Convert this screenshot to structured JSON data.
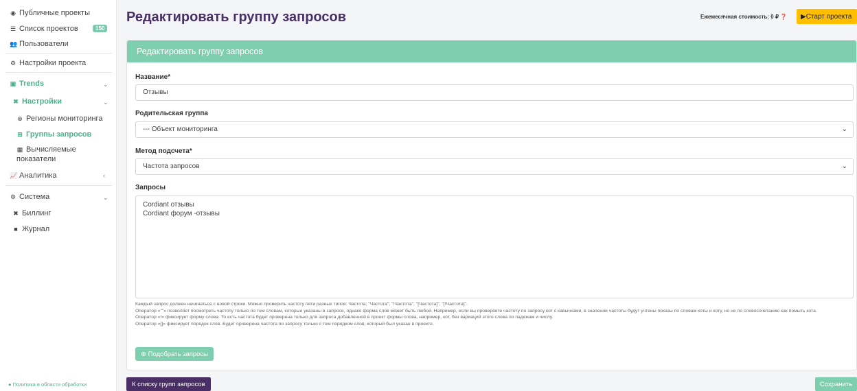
{
  "sidebar": {
    "public_projects": "Публичные проекты",
    "projects_list": "Список проектов",
    "projects_count": "150",
    "users": "Пользователи",
    "project_settings": "Настройки проекта",
    "trends": "Trends",
    "settings": "Настройки",
    "monitoring_regions": "Регионы мониторинга",
    "query_groups": "Группы запросов",
    "computed_line1": "Вычисляемые",
    "computed_line2": "показатели",
    "analytics": "Аналитика",
    "system": "Система",
    "billing": "Биллинг",
    "journal": "Журнал",
    "policy": "Политика в области обработки"
  },
  "header": {
    "title": "Редактировать группу запросов",
    "monthly_cost": "Ежемесячная стоимость: 0 ₽",
    "start_button": "Старт проекта"
  },
  "form": {
    "card_title": "Редактировать группу запросов",
    "name_label": "Название*",
    "name_value": "Отзывы",
    "parent_label": "Родительская группа",
    "parent_value": "--- Объект мониторинга",
    "method_label": "Метод подсчета*",
    "method_value": "Частота запросов",
    "queries_label": "Запросы",
    "query_line1": "Cordiant отзывы",
    "query_line2": "Cordiant форум -отзывы",
    "help1": "Каждый запрос должен начинаться с новой строки. Можно проверить частоту пяти разных типов: Частота; \"Частота\"; \"!Частота\"; \"[Частота]\"; \"[!Частота]\".",
    "help2": "Оператор «\"\"» позволяет посмотреть частоту только по тем словам, которые указаны в запросе, однако форма слов может быть любой. Например, если вы проверяете частоту по запросу кот с кавычками, в значении частоты будут учтены показы по словам коты и коту, но не по словосочетанию как помыть кота.",
    "help3": "Оператор «!» фиксирует форму слова. То есть частота будет проверена только для запроса добавленной в проект формы слова, например, кот, без вариаций этого слова по падежам и числу.",
    "help4": "Оператор «[]» фиксирует порядок слов. Будет проверена частота по запросу только с тем порядком слов, который был указан в проекте.",
    "pick_button": "Подобрать запросы"
  },
  "footer": {
    "back_button": "К списку групп запросов",
    "save_button": "Сохранить"
  },
  "colors": {
    "accent_green": "#7dcfb0",
    "title_purple": "#4a3068",
    "start_yellow": "#ffbf00"
  }
}
